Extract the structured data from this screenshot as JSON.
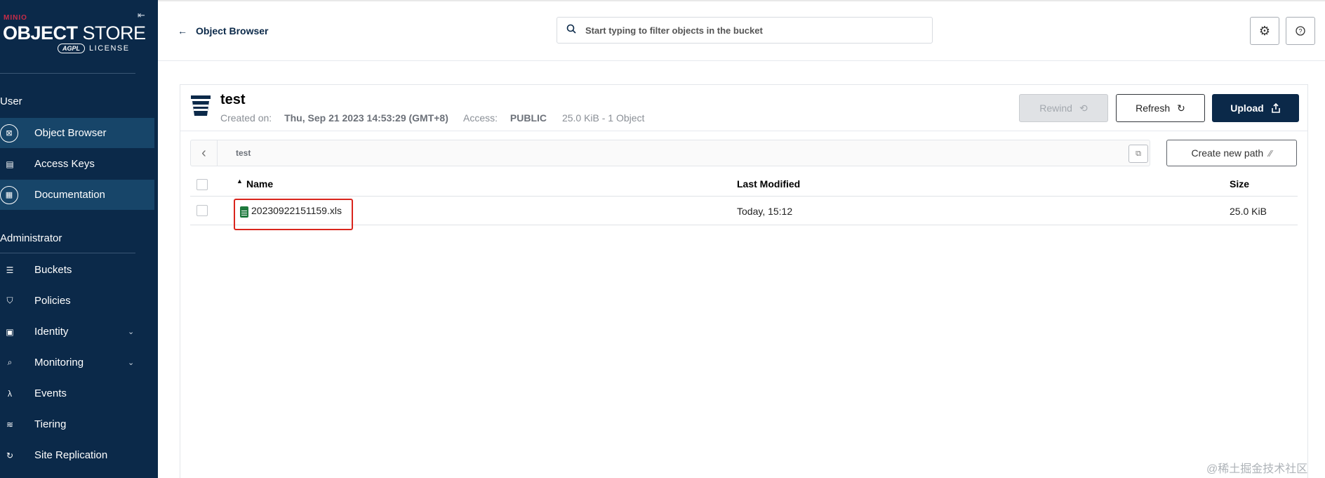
{
  "sidebar": {
    "brand": {
      "minio": "MINIO",
      "title_bold": "OBJECT",
      "title_rest": " STORE",
      "agpl": "AGPL",
      "license": "LICENSE"
    },
    "sections": [
      {
        "label": "User"
      },
      {
        "label": "Administrator"
      }
    ],
    "user_items": [
      {
        "label": "Object Browser",
        "icon": "object-browser-icon"
      },
      {
        "label": "Access Keys",
        "icon": "access-keys-icon"
      },
      {
        "label": "Documentation",
        "icon": "documentation-icon"
      }
    ],
    "admin_items": [
      {
        "label": "Buckets",
        "icon": "buckets-icon"
      },
      {
        "label": "Policies",
        "icon": "policies-icon"
      },
      {
        "label": "Identity",
        "icon": "identity-icon"
      },
      {
        "label": "Monitoring",
        "icon": "monitoring-icon"
      },
      {
        "label": "Events",
        "icon": "events-icon"
      },
      {
        "label": "Tiering",
        "icon": "tiering-icon"
      },
      {
        "label": "Site Replication",
        "icon": "site-replication-icon"
      }
    ]
  },
  "topbar": {
    "back_label": "Object Browser",
    "search_placeholder": "Start typing to filter objects in the bucket"
  },
  "bucket": {
    "name": "test",
    "created_label": "Created on:",
    "created_value": "Thu, Sep 21 2023 14:53:29 (GMT+8)",
    "access_label": "Access:",
    "access_value": "PUBLIC",
    "summary": "25.0 KiB - 1 Object"
  },
  "actions": {
    "rewind": "Rewind",
    "refresh": "Refresh",
    "upload": "Upload",
    "create_path": "Create new path"
  },
  "path": {
    "current": "test"
  },
  "table": {
    "columns": [
      "Name",
      "Last Modified",
      "Size"
    ],
    "rows": [
      {
        "name": "20230922151159.xls",
        "modified": "Today, 15:12",
        "size": "25.0 KiB"
      }
    ]
  },
  "watermark": "@稀土掘金技术社区",
  "colors": {
    "sidebar": "#0b2949",
    "active_item": "#174569",
    "highlight": "#d9251d",
    "brand_red": "#c72c48"
  }
}
